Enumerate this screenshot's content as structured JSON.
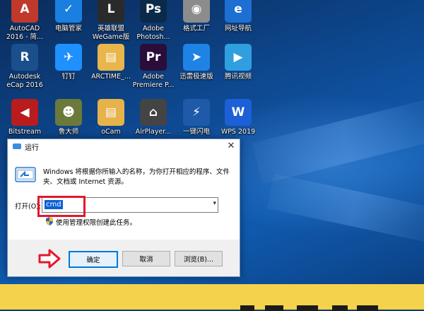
{
  "desktop_icons": [
    {
      "label": "AutoCAD\n2016 - 简...",
      "color": "#c0392b",
      "glyph": "A"
    },
    {
      "label": "电脑管家",
      "color": "#1a7fe0",
      "glyph": "✓"
    },
    {
      "label": "英雄联盟\nWeGame版",
      "color": "#2a2a2a",
      "glyph": "L"
    },
    {
      "label": "Adobe\nPhotosh...",
      "color": "#0b2a4a",
      "glyph": "Ps"
    },
    {
      "label": "格式工厂",
      "color": "#8c8c8c",
      "glyph": "◉"
    },
    {
      "label": "网址导航",
      "color": "#1d6fd1",
      "glyph": "e"
    },
    {
      "label": "Autodesk\neCap 2016",
      "color": "#1a4f8c",
      "glyph": "R"
    },
    {
      "label": "钉钉",
      "color": "#1e90ff",
      "glyph": "✈"
    },
    {
      "label": "ARCTIME_...",
      "color": "#e8b64a",
      "glyph": "▤"
    },
    {
      "label": "Adobe\nPremiere P...",
      "color": "#2a0d3a",
      "glyph": "Pr"
    },
    {
      "label": "迅雷极速版",
      "color": "#1f83e6",
      "glyph": "➤"
    },
    {
      "label": "腾讯视频",
      "color": "#2f9fe0",
      "glyph": "▶"
    },
    {
      "label": "Bitstream",
      "color": "#b91c1c",
      "glyph": "◀"
    },
    {
      "label": "鲁大师",
      "color": "#6b7a3a",
      "glyph": "☻"
    },
    {
      "label": "oCam",
      "color": "#e6b24a",
      "glyph": "▤"
    },
    {
      "label": "AirPlayer...",
      "color": "#444444",
      "glyph": "⌂"
    },
    {
      "label": "一键闪电",
      "color": "#1e5aa8",
      "glyph": "⚡"
    },
    {
      "label": "WPS 2019",
      "color": "#1d5fd6",
      "glyph": "W"
    }
  ],
  "run_dialog": {
    "title": "运行",
    "close_glyph": "✕",
    "description": "Windows 将根据你所输入的名称，为你打开相应的程序、文件夹、文档或 Internet 资源。",
    "open_label": "打开(O):",
    "open_value": "cmd",
    "admin_text": "使用管理权限创建此任务。",
    "buttons": {
      "ok": "确定",
      "cancel": "取消",
      "browse": "浏览(B)..."
    }
  },
  "colors": {
    "highlight": "#e3182d",
    "caption_bar": "#f5d24c",
    "accent": "#0078d7"
  }
}
